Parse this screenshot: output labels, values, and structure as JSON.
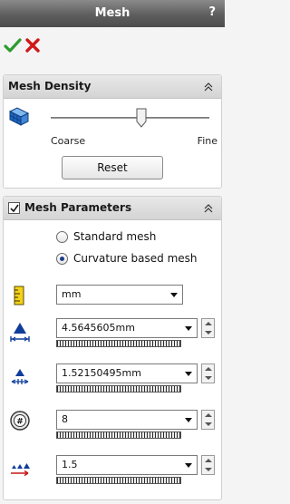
{
  "header": {
    "title": "Mesh",
    "help_label": "?"
  },
  "actions": {
    "ok_icon": "checkmark-icon",
    "cancel_icon": "close-icon"
  },
  "density": {
    "title": "Mesh Density",
    "slider_level": 0.57,
    "coarse_label": "Coarse",
    "fine_label": "Fine",
    "reset_label": "Reset"
  },
  "params": {
    "title": "Mesh Parameters",
    "checked": true,
    "radios": [
      {
        "label": "Standard mesh",
        "selected": false
      },
      {
        "label": "Curvature based mesh",
        "selected": true
      }
    ],
    "units": {
      "value": "mm"
    },
    "max_element_size": {
      "value": "4.5645605mm"
    },
    "min_element_size": {
      "value": "1.52150495mm"
    },
    "min_elements_circle": {
      "value": "8"
    },
    "growth_ratio": {
      "value": "1.5"
    }
  },
  "colors": {
    "title_bar": "#5e5e5e",
    "accent_blue": "#1d64c2",
    "ok_green": "#2e9b2e",
    "cancel_red": "#d11818"
  }
}
